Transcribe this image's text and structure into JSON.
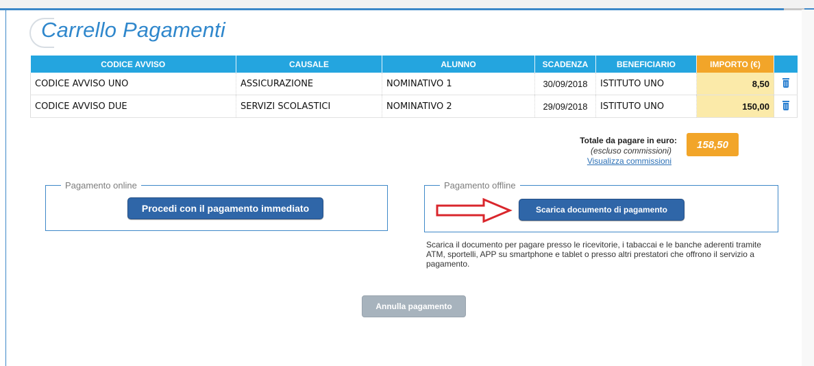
{
  "page": {
    "title": "Carrello Pagamenti"
  },
  "table": {
    "headers": [
      "CODICE AVVISO",
      "CAUSALE",
      "ALUNNO",
      "SCADENZA",
      "BENEFICIARIO",
      "IMPORTO (€)",
      ""
    ],
    "rows": [
      {
        "codice": "CODICE AVVISO UNO",
        "causale": "ASSICURAZIONE",
        "alunno": "NOMINATIVO 1",
        "scadenza": "30/09/2018",
        "beneficiario": "ISTITUTO UNO",
        "importo": "8,50"
      },
      {
        "codice": "CODICE AVVISO DUE",
        "causale": "SERVIZI SCOLASTICI",
        "alunno": "NOMINATIVO 2",
        "scadenza": "29/09/2018",
        "beneficiario": "ISTITUTO UNO",
        "importo": "150,00"
      }
    ]
  },
  "totale": {
    "label": "Totale da pagare in euro:",
    "sub": "(escluso commissioni)",
    "link": "Visualizza commissioni",
    "value": "158,50"
  },
  "online": {
    "legend": "Pagamento online",
    "button": "Procedi con il pagamento immediato"
  },
  "offline": {
    "legend": "Pagamento offline",
    "button": "Scarica documento di pagamento",
    "description": "Scarica il documento per pagare presso le ricevitorie, i tabaccai e le banche aderenti tramite ATM, sportelli, APP su smartphone e tablet o presso altri prestatori che offrono il servizio a pagamento."
  },
  "annulla": {
    "label": "Annulla pagamento"
  },
  "colors": {
    "header": "#24a5df",
    "importo_header": "#f2a529",
    "importo_cell": "#fbeaa9",
    "button": "#2f66a8",
    "arrow": "#d9262c"
  },
  "icons": {
    "delete": "trash-icon",
    "arrow": "right-arrow-icon"
  }
}
